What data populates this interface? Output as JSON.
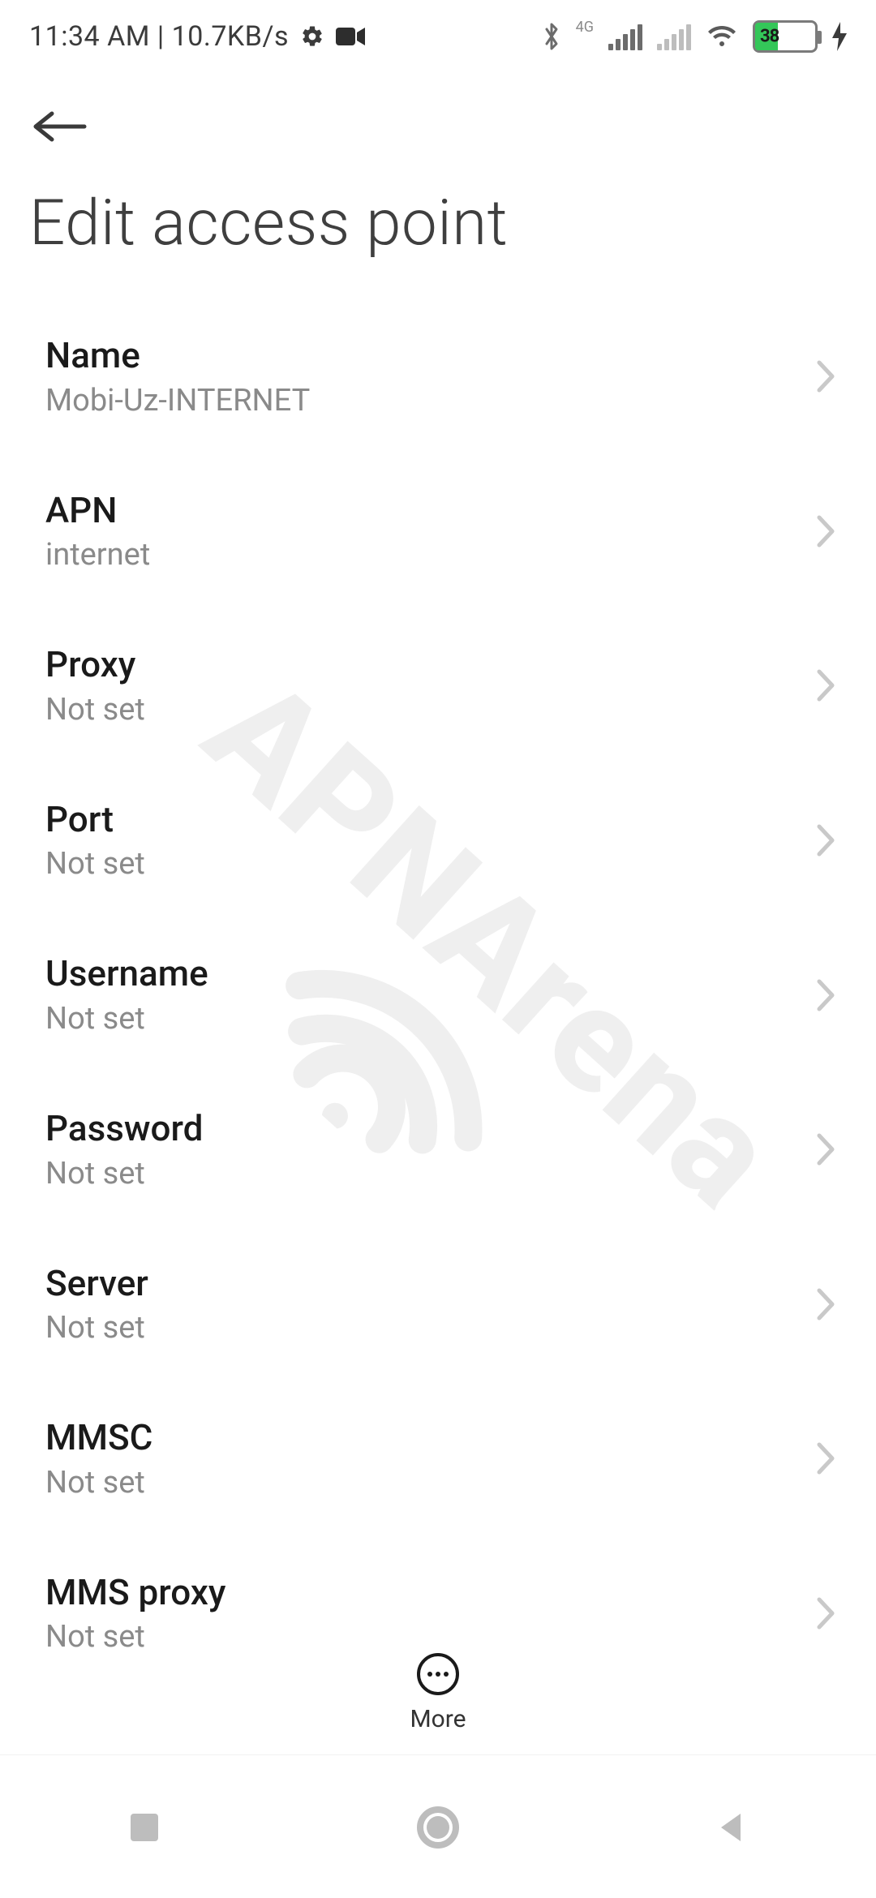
{
  "status": {
    "left_text": "11:34 AM | 10.7KB/s",
    "battery_percent": "38",
    "icons": {
      "gear": "gear-icon",
      "camera": "camera-icon",
      "bluetooth": "bluetooth-icon",
      "net_label": "4G",
      "signal_primary": "signal-icon",
      "signal_secondary": "signal-off-icon",
      "wifi": "wifi-icon",
      "charging": "charging-icon"
    }
  },
  "header": {
    "title": "Edit access point"
  },
  "fields": [
    {
      "label": "Name",
      "value": "Mobi-Uz-INTERNET"
    },
    {
      "label": "APN",
      "value": "internet"
    },
    {
      "label": "Proxy",
      "value": "Not set"
    },
    {
      "label": "Port",
      "value": "Not set"
    },
    {
      "label": "Username",
      "value": "Not set"
    },
    {
      "label": "Password",
      "value": "Not set"
    },
    {
      "label": "Server",
      "value": "Not set"
    },
    {
      "label": "MMSC",
      "value": "Not set"
    },
    {
      "label": "MMS proxy",
      "value": "Not set"
    }
  ],
  "bottom": {
    "more_label": "More"
  },
  "watermark": {
    "text": "APNArena"
  },
  "colors": {
    "battery_fill": "#34c759",
    "text_primary": "#1a1a1a",
    "text_secondary": "#8a8a8a",
    "chevron": "#bdbdbd"
  }
}
